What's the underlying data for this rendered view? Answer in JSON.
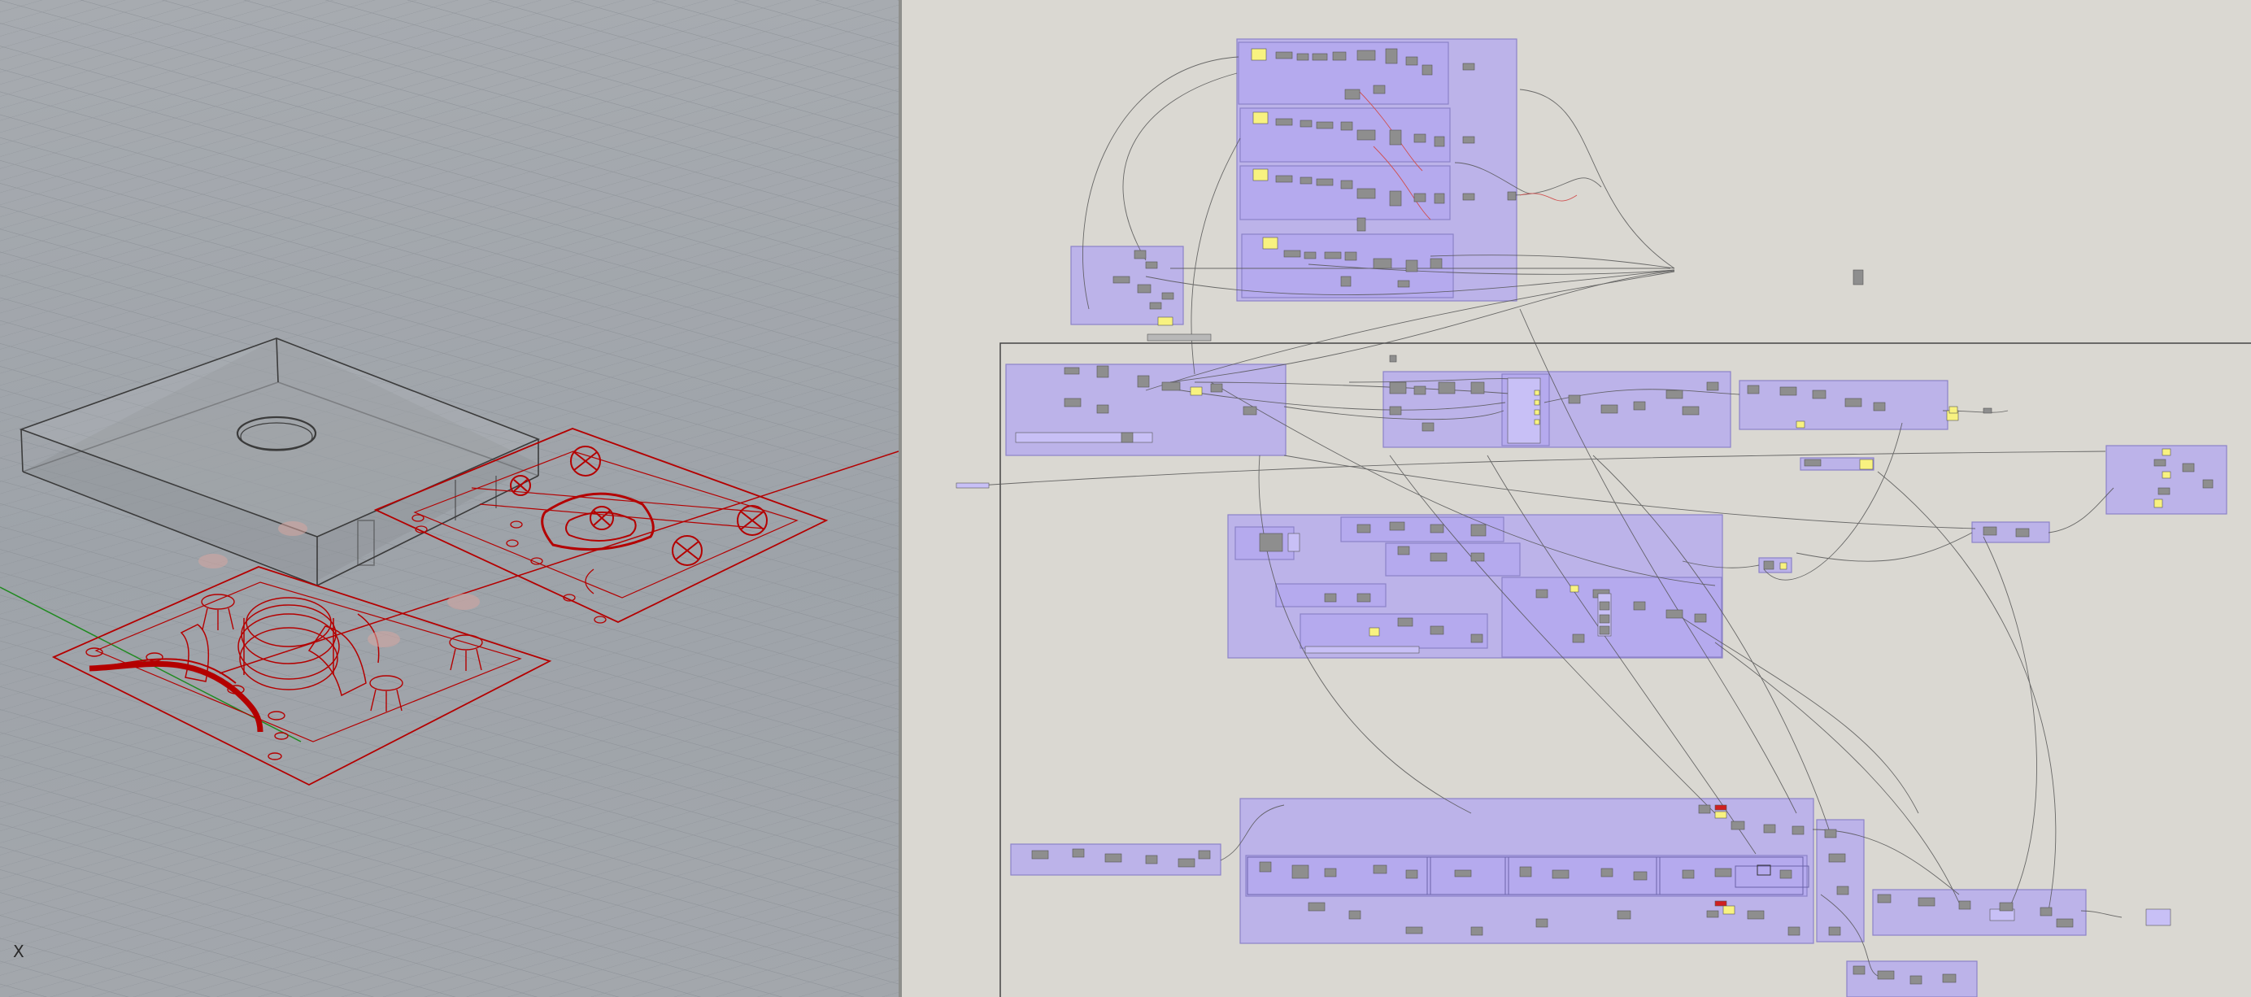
{
  "viewport": {
    "axis_label": "X",
    "model_color": "#b40000",
    "grid_color": "#8d9298",
    "background_color": "#a3a7ac"
  },
  "canvas": {
    "background_color": "#dad8d2",
    "group_color": "#b4a8f0",
    "group_border": "#8c82c8",
    "component_color": "#8e8e8e",
    "wire_color": "#555555",
    "slider_color": "#f8f280",
    "error_color": "#d02020"
  }
}
